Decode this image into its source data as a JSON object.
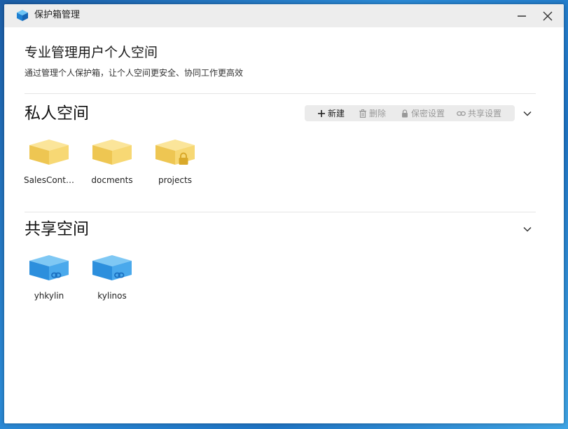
{
  "window": {
    "title": "保护箱管理",
    "minimize_icon": "minimize-icon",
    "close_icon": "close-icon"
  },
  "header": {
    "title": "专业管理用户个人空间",
    "subtitle": "通过管理个人保护箱，让个人空间更安全、协同工作更高效"
  },
  "private_space": {
    "title": "私人空间",
    "toolbar": {
      "new_label": "新建",
      "delete_label": "删除",
      "security_label": "保密设置",
      "share_label": "共享设置"
    },
    "items": [
      {
        "label": "SalesCont…",
        "icon": "folder-box-icon",
        "locked": false
      },
      {
        "label": "docments",
        "icon": "folder-box-icon",
        "locked": false
      },
      {
        "label": "projects",
        "icon": "locked-folder-box-icon",
        "locked": true
      }
    ]
  },
  "shared_space": {
    "title": "共享空间",
    "items": [
      {
        "label": "yhkylin",
        "icon": "shared-box-icon"
      },
      {
        "label": "kylinos",
        "icon": "shared-box-icon"
      }
    ]
  },
  "colors": {
    "private_box": "#f5d66e",
    "shared_box": "#3ea2ea",
    "titlebar": "#ededed",
    "toolbar_bg": "#ebebeb"
  }
}
